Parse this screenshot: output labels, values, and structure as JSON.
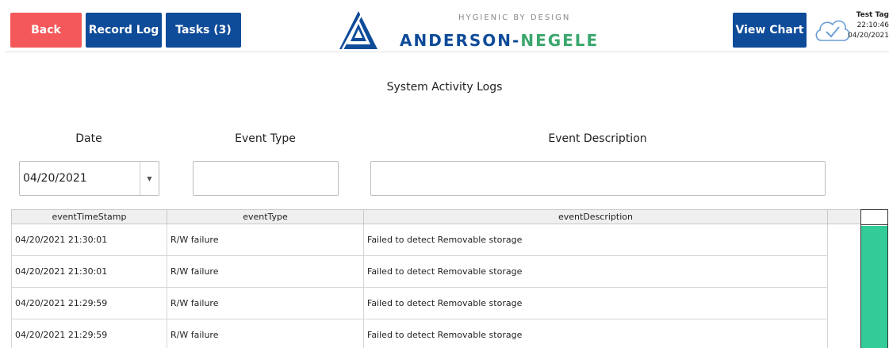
{
  "header": {
    "back_label": "Back",
    "record_log_label": "Record Log",
    "tasks_label": "Tasks (3)",
    "view_chart_label": "View Chart",
    "logo": {
      "tagline": "HYGIENIC BY DESIGN",
      "name_part1": "ANDERSON-",
      "name_part2": "NEGELE"
    },
    "cloud_icon": "cloud-check-icon",
    "tag": {
      "name": "Test Tag",
      "time": "22:10:46",
      "date": "04/20/2021"
    }
  },
  "page_title": "System Activity Logs",
  "filters": {
    "date_label": "Date",
    "date_value": "04/20/2021",
    "event_type_label": "Event Type",
    "event_type_value": "",
    "event_description_label": "Event Description",
    "event_description_value": ""
  },
  "table": {
    "columns": [
      "eventTimeStamp",
      "eventType",
      "eventDescription"
    ],
    "rows": [
      [
        "04/20/2021 21:30:01",
        "R/W failure",
        "Failed to detect Removable storage"
      ],
      [
        "04/20/2021 21:30:01",
        "R/W failure",
        "Failed to detect Removable storage"
      ],
      [
        "04/20/2021 21:29:59",
        "R/W failure",
        "Failed to detect Removable storage"
      ],
      [
        "04/20/2021 21:29:59",
        "R/W failure",
        "Failed to detect Removable storage"
      ]
    ]
  },
  "colors": {
    "back_button": "#f4585a",
    "primary_button": "#0e4b99",
    "brand_green": "#3aa76d",
    "scroll_thumb": "#33cc99"
  }
}
